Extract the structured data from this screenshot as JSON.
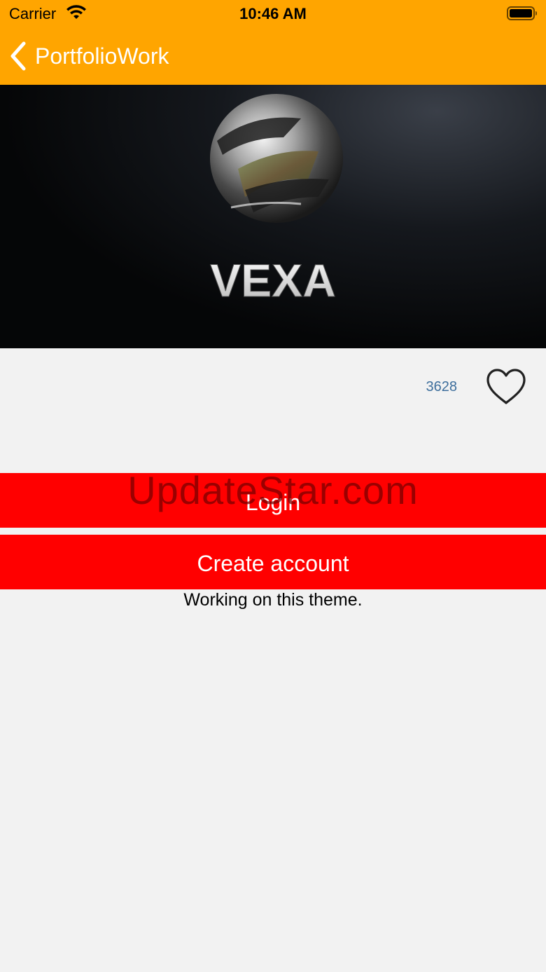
{
  "status_bar": {
    "carrier": "Carrier",
    "time": "10:46 AM"
  },
  "nav": {
    "back_label": "PortfolioWork",
    "bar_color": "#ffa500"
  },
  "banner": {
    "logo_text": "VEXA"
  },
  "stats": {
    "likes": "3628",
    "like_icon": "heart-outline-icon"
  },
  "buttons": {
    "login": "Login",
    "create_account": "Create account",
    "color": "#ff0000"
  },
  "description": "Working on this theme.",
  "watermark": "UpdateStar.com"
}
